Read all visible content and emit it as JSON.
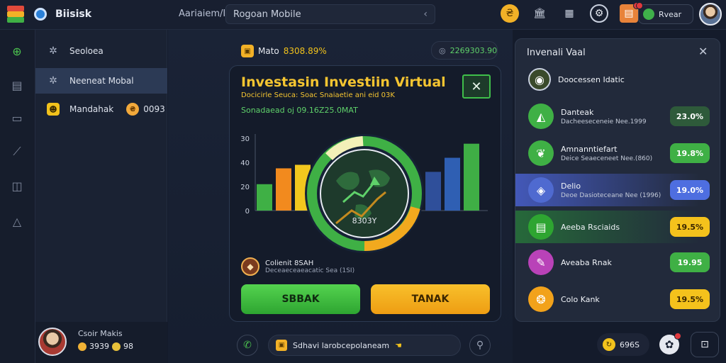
{
  "app": {
    "name": "Biisisk"
  },
  "header": {
    "crumb": "Aariaiem/I",
    "search_value": "Rogoan Mobile",
    "user_label": "Rvear",
    "icons": [
      "coin-icon",
      "bank-icon",
      "calendar-icon",
      "settings-icon",
      "wallet-icon"
    ]
  },
  "rail": {
    "icons": [
      "money-icon",
      "document-icon",
      "monitor-icon",
      "chart-icon",
      "stats-icon",
      "target-icon"
    ]
  },
  "sidebar": {
    "items": [
      {
        "label": "Seoloea",
        "icon": "gear-icon"
      },
      {
        "label": "Neeneat Mobal",
        "icon": "gear-icon"
      },
      {
        "label": "Mandahak",
        "icon": "face-icon",
        "value": "0093"
      }
    ],
    "profile": {
      "name": "Csoir Makis",
      "coins": "3939",
      "gems": "98"
    }
  },
  "main": {
    "chip_left": {
      "label": "Mato",
      "value": "8308.89%"
    },
    "chip_right": {
      "value": "2269303.90"
    },
    "card": {
      "title": "Investasin Investiin Virtual",
      "subtitle": "Docicirle Seuca: Soac Snaiaetie ani eid 03K",
      "subtitle2": "Sonadaead oj 09.16Z25.0MAT",
      "chart_value": "8303Y",
      "asset_name": "Colienit 8SAH",
      "asset_desc": "Deceaeceaeacatic Sea (1SI)",
      "buy_label": "SBBAK",
      "sell_label": "TANAK"
    },
    "bottom": {
      "pill_text": "Sdhavi  larobcepolaneam"
    }
  },
  "chart_data": {
    "type": "bar",
    "yticks": [
      "0",
      "20",
      "40",
      "30"
    ],
    "left_bars": [
      {
        "value": 15,
        "color": "#3fb045"
      },
      {
        "value": 24,
        "color": "#f28a1e"
      },
      {
        "value": 26,
        "color": "#f2c71e"
      }
    ],
    "right_bars": [
      {
        "value": 22,
        "color": "#2f4f9a"
      },
      {
        "value": 30,
        "color": "#2f5fb3"
      },
      {
        "value": 38,
        "color": "#3fae45"
      }
    ],
    "ymax": 44
  },
  "panel": {
    "title": "Invenali Vaal",
    "rows": [
      {
        "name": "Doocessen Idatic",
        "desc": "",
        "pct": "",
        "icon_bg": "#3a4a2a",
        "row_bg": "transparent",
        "pct_bg": "",
        "icon": "globe-icon"
      },
      {
        "name": "Danteak",
        "desc": "Dacheeseceneie Nee.1999",
        "pct": "23.0%",
        "icon_bg": "#3fb045",
        "row_bg": "transparent",
        "pct_bg": "#2e5a3a",
        "icon": "chart-icon"
      },
      {
        "name": "Amnanntiefart",
        "desc": "Deice Seaeceneet Nee.(860)",
        "pct": "19.8%",
        "icon_bg": "#3fb045",
        "row_bg": "transparent",
        "pct_bg": "#3fb045",
        "icon": "leaf-icon"
      },
      {
        "name": "Delio",
        "desc": "Deoe Dasioteceane Nee (1996)",
        "pct": "19.0%",
        "icon_bg": "#4f6ad0",
        "row_bg": "#4358b8",
        "pct_bg": "#4e6ee0",
        "icon": "diamond-icon"
      },
      {
        "name": "Aeeba Rsciaids",
        "desc": "",
        "pct": "19.5%",
        "icon_bg": "#2ea531",
        "row_bg": "#26693a",
        "pct_bg": "#f4c21c",
        "icon": "document-icon"
      },
      {
        "name": "Aveaba Rnak",
        "desc": "",
        "pct": "19.95",
        "icon_bg": "#b942b8",
        "row_bg": "transparent",
        "pct_bg": "#3fb045",
        "icon": "pin-icon"
      },
      {
        "name": "Colo Kank",
        "desc": "",
        "pct": "19.5%",
        "icon_bg": "#f2a21b",
        "row_bg": "transparent",
        "pct_bg": "#f4c21c",
        "icon": "swirl-icon"
      }
    ]
  },
  "footer_right": {
    "label": "696S"
  },
  "colors": {
    "accent_green": "#3fb045",
    "accent_yellow": "#f4c21c",
    "accent_blue": "#4e6ee0"
  }
}
